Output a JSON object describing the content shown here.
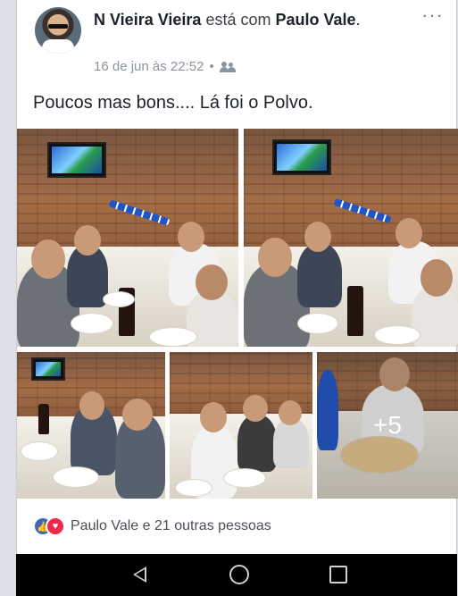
{
  "post": {
    "author": "N Vieira Vieira",
    "connector": "está com",
    "tagged": "Paulo Vale",
    "date": "16 de jun às 22:52",
    "separator": "•",
    "privacy_icon": "friends-icon",
    "more_icon": "more-options-icon",
    "text": "Poucos mas bons.... Lá foi o Polvo."
  },
  "photos": {
    "extra_count_label": "+5",
    "items": [
      {
        "name": "photo-1"
      },
      {
        "name": "photo-2"
      },
      {
        "name": "photo-3"
      },
      {
        "name": "photo-4"
      },
      {
        "name": "photo-5"
      }
    ]
  },
  "reactions": {
    "icons": [
      "like-icon",
      "love-icon"
    ],
    "summary": "Paulo Vale e 21 outras pessoas"
  },
  "android_nav": {
    "buttons": [
      "back-icon",
      "home-icon",
      "recent-apps-icon"
    ]
  },
  "colors": {
    "like": "#4267b2",
    "love": "#f0284a",
    "text": "#1d2129",
    "meta": "#8d939c"
  }
}
